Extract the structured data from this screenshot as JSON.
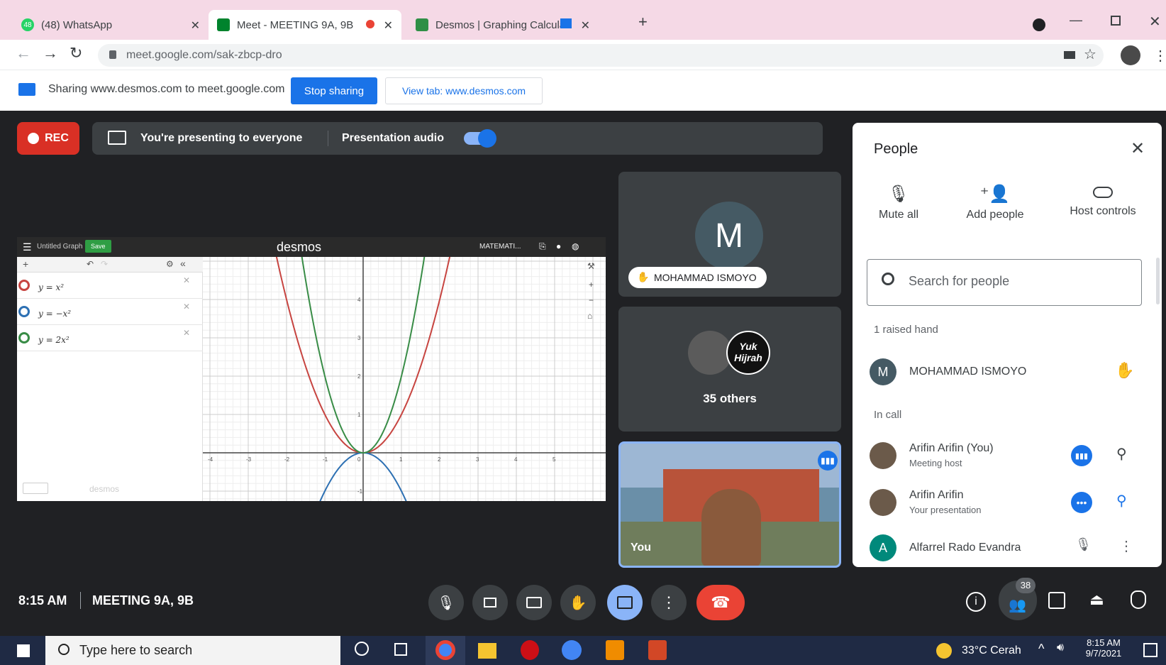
{
  "browser": {
    "tabs": [
      {
        "label": "(48) WhatsApp",
        "badge": "48"
      },
      {
        "label": "Meet - MEETING 9A, 9B"
      },
      {
        "label": "Desmos | Graphing Calculato"
      }
    ],
    "url": "meet.google.com/sak-zbcp-dro",
    "new_tab": "+"
  },
  "infobar": {
    "message": "Sharing www.desmos.com to meet.google.com",
    "stop_label": "Stop sharing",
    "view_label": "View tab: www.desmos.com"
  },
  "meet": {
    "rec_label": "REC",
    "presenting_text": "You're presenting to everyone",
    "presentation_audio": "Presentation audio",
    "time": "8:15 AM",
    "meeting_name": "MEETING 9A, 9B",
    "people_badge": "38"
  },
  "desmos": {
    "title": "Untitled Graph",
    "save": "Save",
    "brand": "desmos",
    "folder": "MATEMATI...",
    "watermark": "desmos",
    "expressions": [
      {
        "latex": "y = x²",
        "color": "#c74440"
      },
      {
        "latex": "y = −x²",
        "color": "#2d70b3"
      },
      {
        "latex": "y = 2x²",
        "color": "#388c46"
      }
    ],
    "x_ticks": [
      "-4",
      "-3",
      "-2",
      "-1",
      "0",
      "1",
      "2",
      "3",
      "4",
      "5"
    ],
    "y_ticks": [
      "4",
      "3",
      "2",
      "1",
      "-1"
    ]
  },
  "tiles": {
    "main_initial": "M",
    "main_name": "MOHAMMAD ISMOYO",
    "others_label": "35 others",
    "yuk_line1": "Yuk",
    "yuk_line2": "Hijrah",
    "self_label": "You"
  },
  "people": {
    "title": "People",
    "mute_all": "Mute all",
    "add_people": "Add people",
    "host_controls": "Host controls",
    "search_placeholder": "Search for people",
    "raised_heading": "1 raised hand",
    "incall_heading": "In call",
    "raised": [
      {
        "initial": "M",
        "name": "MOHAMMAD ISMOYO"
      }
    ],
    "incall": [
      {
        "name": "Arifin Arifin (You)",
        "sub": "Meeting host"
      },
      {
        "name": "Arifin Arifin",
        "sub": "Your presentation"
      },
      {
        "initial": "A",
        "name": "Alfarrel Rado Evandra"
      }
    ]
  },
  "taskbar": {
    "search": "Type here to search",
    "weather": "33°C  Cerah",
    "time": "8:15 AM",
    "date": "9/7/2021"
  }
}
